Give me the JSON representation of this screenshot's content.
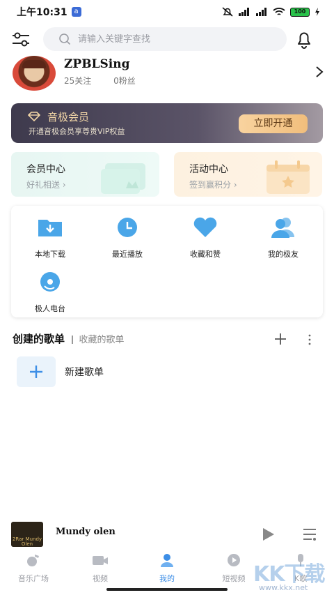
{
  "status_bar": {
    "time": "上午10:31",
    "app_badge": "a",
    "battery": "100"
  },
  "search": {
    "placeholder": "请输入关键字查找"
  },
  "profile": {
    "name": "ZPBLSing",
    "following": "25关注",
    "fans": "0粉丝"
  },
  "vip_banner": {
    "title": "音极会员",
    "subtitle": "开通音极会员享尊贵VIP权益",
    "button": "立即开通"
  },
  "cards": {
    "member": {
      "title": "会员中心",
      "subtitle": "好礼相送 ›"
    },
    "activity": {
      "title": "活动中心",
      "subtitle": "签到赢积分 ›"
    }
  },
  "shortcuts": [
    {
      "label": "本地下载",
      "icon": "folder-download-icon"
    },
    {
      "label": "最近播放",
      "icon": "clock-icon"
    },
    {
      "label": "收藏和赞",
      "icon": "heart-icon"
    },
    {
      "label": "我的极友",
      "icon": "friends-icon"
    },
    {
      "label": "极人电台",
      "icon": "radio-disc-icon"
    }
  ],
  "playlists": {
    "tab_created": "创建的歌单",
    "tab_collected": "收藏的歌单",
    "new_playlist": "新建歌单"
  },
  "player": {
    "song": "Mundy olen",
    "cover_text": "2Rar Mundy Olen"
  },
  "bottom_nav": [
    {
      "label": "音乐广场",
      "icon": "music-square-icon",
      "active": false
    },
    {
      "label": "视频",
      "icon": "video-icon",
      "active": false
    },
    {
      "label": "我的",
      "icon": "user-icon",
      "active": true
    },
    {
      "label": "短视频",
      "icon": "short-video-icon",
      "active": false
    },
    {
      "label": "K歌",
      "icon": "karaoke-icon",
      "active": false
    }
  ],
  "watermark": {
    "text": "KK下载",
    "url": "www.kkx.net"
  },
  "colors": {
    "accent": "#3d8ee6",
    "vip_gold": "#f1be7c"
  }
}
